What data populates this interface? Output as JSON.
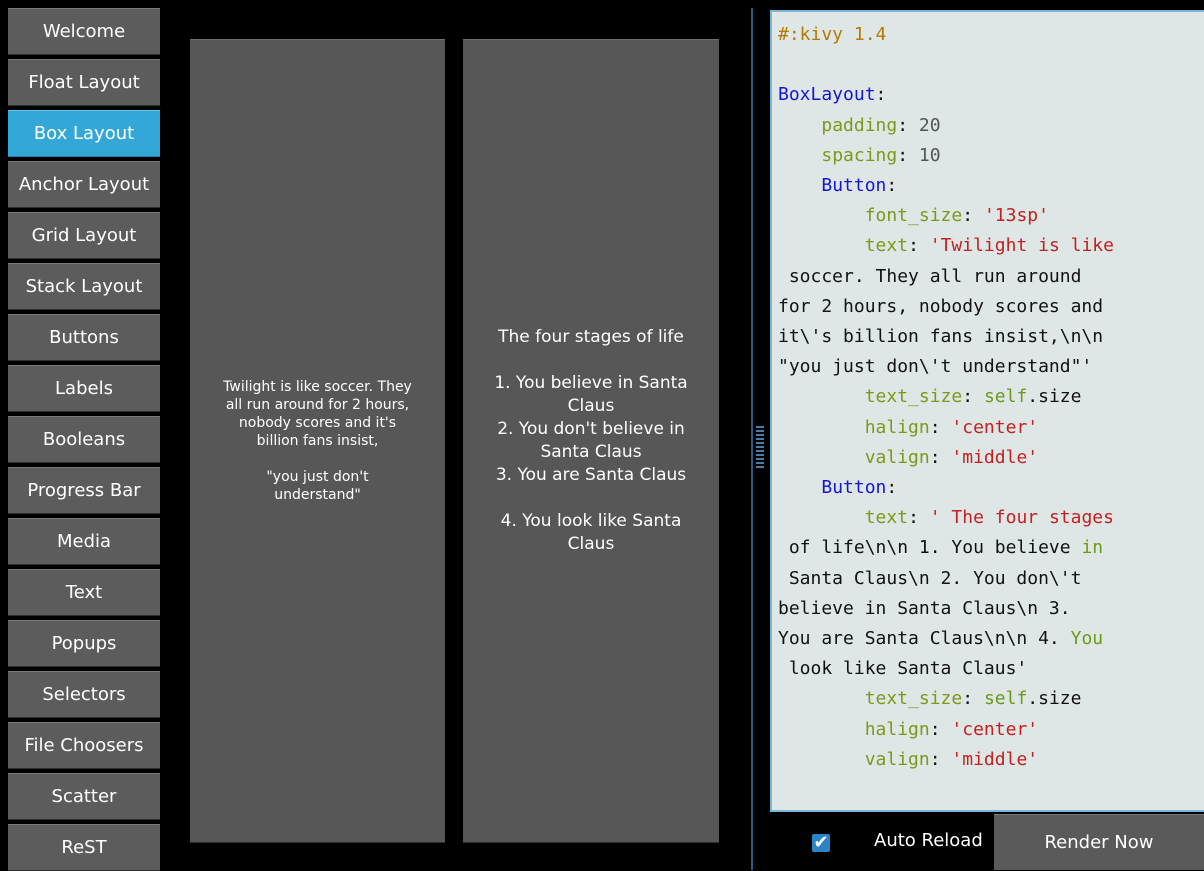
{
  "sidebar": {
    "items": [
      {
        "label": "Welcome",
        "active": false
      },
      {
        "label": "Float Layout",
        "active": false
      },
      {
        "label": "Box Layout",
        "active": true
      },
      {
        "label": "Anchor Layout",
        "active": false
      },
      {
        "label": "Grid Layout",
        "active": false
      },
      {
        "label": "Stack Layout",
        "active": false
      },
      {
        "label": "Buttons",
        "active": false
      },
      {
        "label": "Labels",
        "active": false
      },
      {
        "label": "Booleans",
        "active": false
      },
      {
        "label": "Progress Bar",
        "active": false
      },
      {
        "label": "Media",
        "active": false
      },
      {
        "label": "Text",
        "active": false
      },
      {
        "label": "Popups",
        "active": false
      },
      {
        "label": "Selectors",
        "active": false
      },
      {
        "label": "File Choosers",
        "active": false
      },
      {
        "label": "Scatter",
        "active": false
      },
      {
        "label": "ReST",
        "active": false
      }
    ]
  },
  "demo": {
    "button1_text": "Twilight is like soccer. They\nall run around for 2 hours,\nnobody scores and it's\nbillion fans insist,\n\n\"you just don't\nunderstand\"",
    "button2_text": "The four stages of life\n\n1. You believe in Santa\nClaus\n2. You don't believe in\nSanta Claus\n3. You are Santa Claus\n\n4. You look like Santa\nClaus"
  },
  "editor": {
    "lines": [
      [
        [
          "comment",
          "#:kivy 1.4"
        ]
      ],
      [],
      [
        [
          "class",
          "BoxLayout"
        ],
        [
          "plain",
          ":"
        ]
      ],
      [
        [
          "plain",
          "    "
        ],
        [
          "key",
          "padding"
        ],
        [
          "plain",
          ": "
        ],
        [
          "num",
          "20"
        ]
      ],
      [
        [
          "plain",
          "    "
        ],
        [
          "key",
          "spacing"
        ],
        [
          "plain",
          ": "
        ],
        [
          "num",
          "10"
        ]
      ],
      [
        [
          "plain",
          "    "
        ],
        [
          "class",
          "Button"
        ],
        [
          "plain",
          ":"
        ]
      ],
      [
        [
          "plain",
          "        "
        ],
        [
          "key",
          "font_size"
        ],
        [
          "plain",
          ": "
        ],
        [
          "str",
          "'13sp'"
        ]
      ],
      [
        [
          "plain",
          "        "
        ],
        [
          "key",
          "text"
        ],
        [
          "plain",
          ": "
        ],
        [
          "str",
          "'Twilight is like"
        ]
      ],
      [
        [
          "plain",
          " soccer. They all run around"
        ]
      ],
      [
        [
          "plain",
          "for 2 hours, nobody scores and"
        ]
      ],
      [
        [
          "plain",
          "it\\'s billion fans insist,\\n\\n"
        ]
      ],
      [
        [
          "plain",
          "\"you just don\\'t understand\"'"
        ]
      ],
      [
        [
          "plain",
          "        "
        ],
        [
          "key",
          "text_size"
        ],
        [
          "plain",
          ": "
        ],
        [
          "green",
          "self"
        ],
        [
          "plain",
          ".size"
        ]
      ],
      [
        [
          "plain",
          "        "
        ],
        [
          "key",
          "halign"
        ],
        [
          "plain",
          ": "
        ],
        [
          "str",
          "'center'"
        ]
      ],
      [
        [
          "plain",
          "        "
        ],
        [
          "key",
          "valign"
        ],
        [
          "plain",
          ": "
        ],
        [
          "str",
          "'middle'"
        ]
      ],
      [
        [
          "plain",
          "    "
        ],
        [
          "class",
          "Button"
        ],
        [
          "plain",
          ":"
        ]
      ],
      [
        [
          "plain",
          "        "
        ],
        [
          "key",
          "text"
        ],
        [
          "plain",
          ": "
        ],
        [
          "str",
          "' The four stages"
        ]
      ],
      [
        [
          "plain",
          " of life\\n\\n 1. You believe "
        ],
        [
          "green",
          "in"
        ]
      ],
      [
        [
          "plain",
          " Santa Claus\\n 2. You don\\'t"
        ]
      ],
      [
        [
          "plain",
          "believe in Santa Claus\\n 3."
        ]
      ],
      [
        [
          "plain",
          "You are Santa Claus\\n\\n 4. "
        ],
        [
          "green",
          "You"
        ]
      ],
      [
        [
          "plain",
          " look like Santa Claus'"
        ]
      ],
      [
        [
          "plain",
          "        "
        ],
        [
          "key",
          "text_size"
        ],
        [
          "plain",
          ": "
        ],
        [
          "green",
          "self"
        ],
        [
          "plain",
          ".size"
        ]
      ],
      [
        [
          "plain",
          "        "
        ],
        [
          "key",
          "halign"
        ],
        [
          "plain",
          ": "
        ],
        [
          "str",
          "'center'"
        ]
      ],
      [
        [
          "plain",
          "        "
        ],
        [
          "key",
          "valign"
        ],
        [
          "plain",
          ": "
        ],
        [
          "str",
          "'middle'"
        ]
      ]
    ]
  },
  "bottom": {
    "auto_reload_label": "Auto Reload",
    "auto_reload_checked": true,
    "render_now_label": "Render Now"
  },
  "colors": {
    "active_nav": "#33a8d8",
    "button_gray": "#5c5c5c",
    "editor_bg": "#dfe6e6",
    "checkbox": "#2a85c6"
  }
}
